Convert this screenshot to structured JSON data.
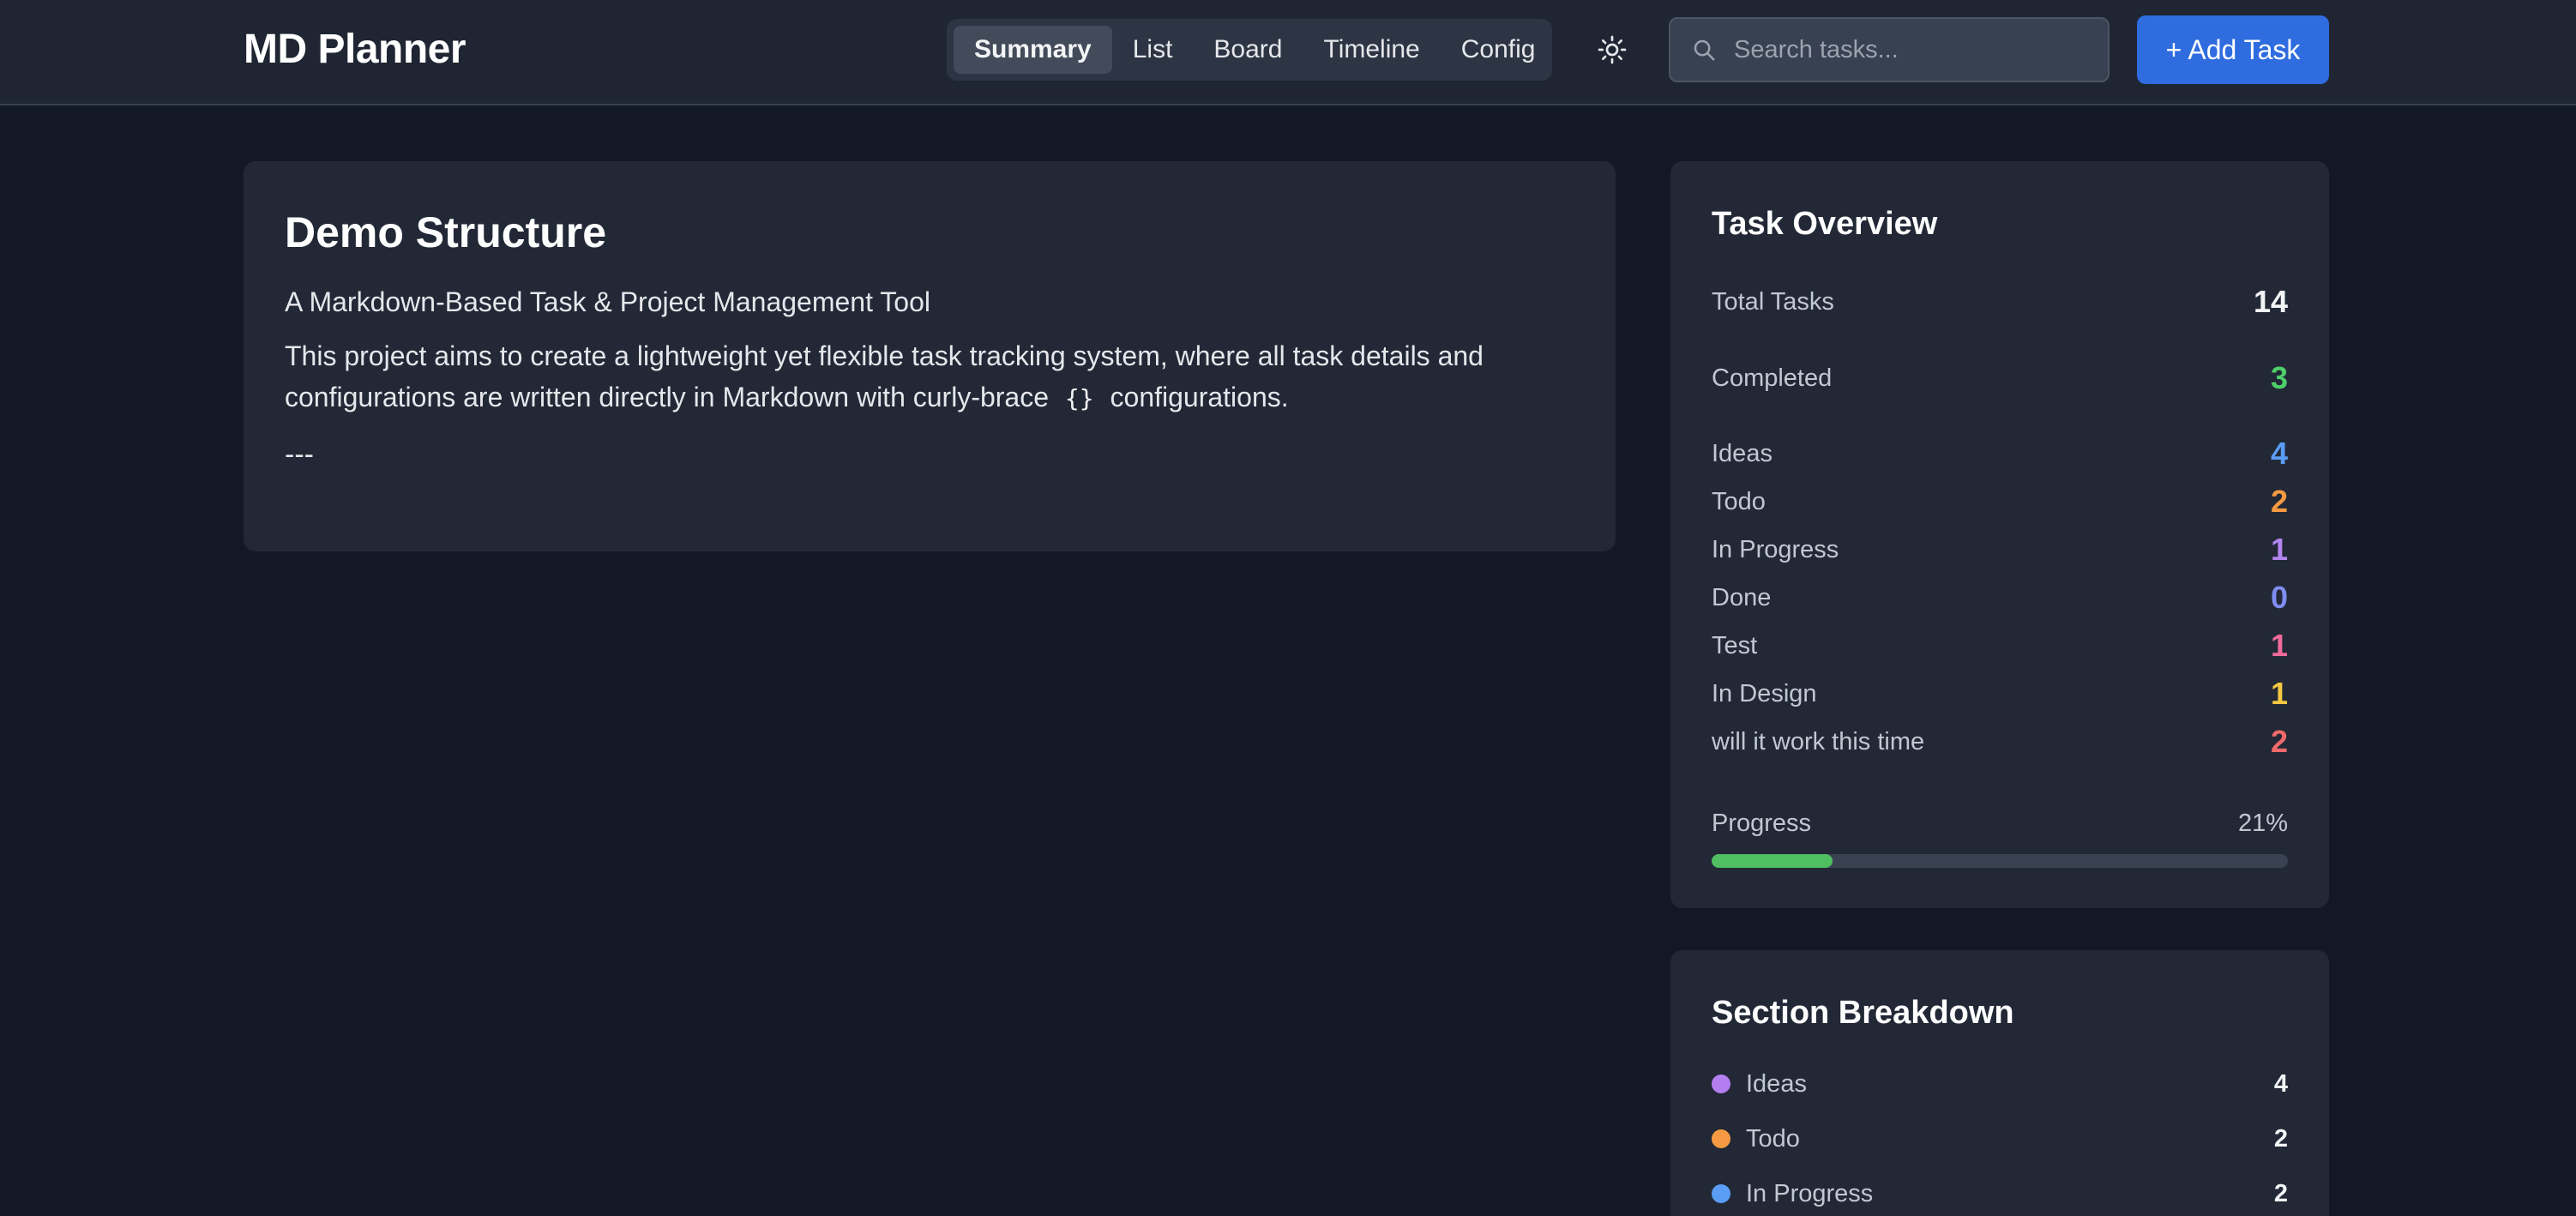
{
  "app": {
    "title": "MD Planner"
  },
  "nav": {
    "tabs": [
      {
        "label": "Summary",
        "active": true
      },
      {
        "label": "List"
      },
      {
        "label": "Board"
      },
      {
        "label": "Timeline"
      },
      {
        "label": "Config"
      }
    ]
  },
  "header": {
    "theme_icon": "sun-icon",
    "search": {
      "placeholder": "Search tasks...",
      "value": ""
    },
    "add_task_label": "+ Add Task"
  },
  "project": {
    "title": "Demo Structure",
    "subtitle": "A Markdown-Based Task & Project Management Tool",
    "description_before": "This project aims to create a lightweight yet flexible task tracking system, where all task details and configurations are written directly in Markdown with curly-brace",
    "description_code": "{}",
    "description_after": "configurations.",
    "separator": "---"
  },
  "overview": {
    "title": "Task Overview",
    "total": {
      "label": "Total Tasks",
      "value": "14"
    },
    "completed": {
      "label": "Completed",
      "value": "3",
      "color": "#4fcf6a"
    },
    "sections": [
      {
        "label": "Ideas",
        "value": "4",
        "color": "#5b9df5"
      },
      {
        "label": "Todo",
        "value": "2",
        "color": "#f59a42"
      },
      {
        "label": "In Progress",
        "value": "1",
        "color": "#b385f0"
      },
      {
        "label": "Done",
        "value": "0",
        "color": "#7f8cf0"
      },
      {
        "label": "Test",
        "value": "1",
        "color": "#f06a9b"
      },
      {
        "label": "In Design",
        "value": "1",
        "color": "#f5c842"
      },
      {
        "label": "will it work this time",
        "value": "2",
        "color": "#f06a6a"
      }
    ],
    "progress": {
      "label": "Progress",
      "text": "21%",
      "value": 0.21,
      "color": "#4fbf62"
    }
  },
  "breakdown": {
    "title": "Section Breakdown",
    "items": [
      {
        "label": "Ideas",
        "count": "4",
        "color": "#b57ef0"
      },
      {
        "label": "Todo",
        "count": "2",
        "color": "#f59a42"
      },
      {
        "label": "In Progress",
        "count": "2",
        "color": "#5b9df5"
      }
    ]
  }
}
